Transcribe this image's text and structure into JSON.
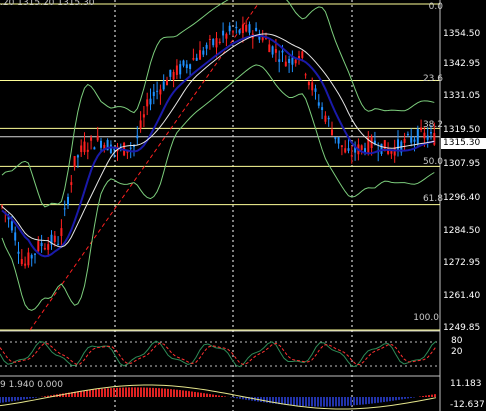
{
  "header": {
    "ohlc_text": ".20 1315.20 1315.30"
  },
  "price_axis": {
    "labels": [
      "1354.50",
      "1342.95",
      "1331.05",
      "1319.50",
      "1307.95",
      "1296.40",
      "1284.50",
      "1272.95",
      "1261.40",
      "1249.85"
    ],
    "current_price": "1315.30"
  },
  "fibonacci": {
    "levels": [
      {
        "label": "0.0",
        "value": 1366
      },
      {
        "label": "23.6",
        "value": 1336.8
      },
      {
        "label": "38.2",
        "value": 1318.5
      },
      {
        "label": "50.0",
        "value": 1304
      },
      {
        "label": "61.8",
        "value": 1289.4
      },
      {
        "label": "100.0",
        "value": 1241.5
      }
    ],
    "line_color": "#ffff99",
    "trend_line_color": "#ff2020"
  },
  "oscillator": {
    "labels": [
      "80",
      "20"
    ]
  },
  "macd": {
    "header_text": "9 1.940 0.000",
    "top_label": "11.183",
    "bottom_label": "-12.637"
  },
  "colors": {
    "background": "#000000",
    "up_candle": "#ff2020",
    "down_candle": "#1e90ff",
    "bands": "#7ccd7c",
    "ma_fast": "#1a1aaa",
    "ma_slow": "#e6e6e6",
    "grid": "#ffffff"
  }
}
